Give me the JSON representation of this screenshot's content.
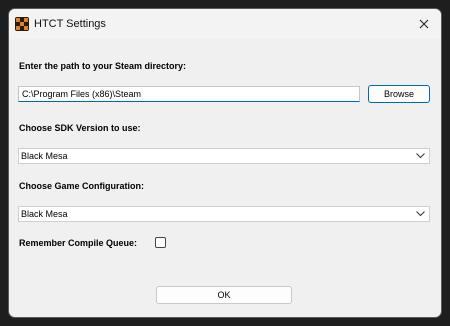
{
  "window": {
    "title": "HTCT Settings"
  },
  "steam": {
    "label": "Enter the path to your Steam directory:",
    "path_value": "C:\\Program Files (x86)\\Steam",
    "browse_label": "Browse"
  },
  "sdk": {
    "label": "Choose SDK Version to use:",
    "selected": "Black Mesa"
  },
  "game": {
    "label": "Choose Game Configuration:",
    "selected": "Black Mesa"
  },
  "queue": {
    "label": "Remember Compile Queue:",
    "checked": false
  },
  "footer": {
    "ok_label": "OK"
  },
  "icons": {
    "app": "htct-app-icon",
    "close": "close-icon",
    "dropdown": "chevron-down-icon"
  },
  "colors": {
    "accent": "#0067c0",
    "window_bg": "#f0f0f0",
    "titlebar_bg": "#f3f3f3"
  }
}
